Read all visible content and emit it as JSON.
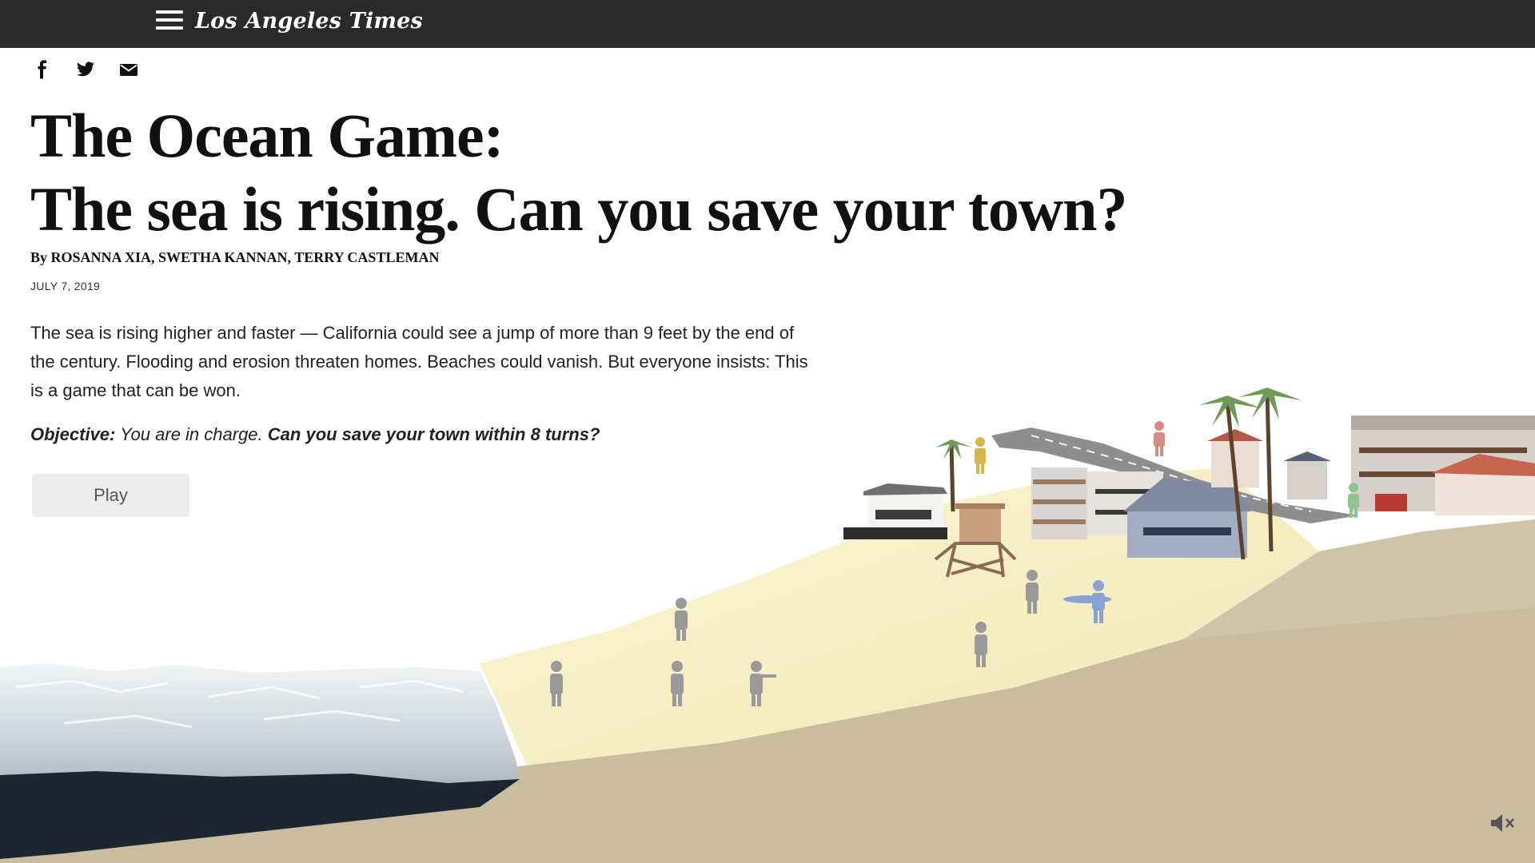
{
  "header": {
    "menu_icon": "hamburger-menu-icon",
    "logo_text": "Los Angeles Times",
    "background": "#2a2a2a"
  },
  "share": {
    "items": [
      {
        "name": "facebook-icon"
      },
      {
        "name": "twitter-icon"
      },
      {
        "name": "email-icon"
      }
    ]
  },
  "article": {
    "headline_line1": "The Ocean Game:",
    "headline_line2": "The sea is rising. Can you save your town?",
    "byline": "By ROSANNA XIA, SWETHA KANNAN, TERRY CASTLEMAN",
    "date": "JULY 7, 2019",
    "intro": "The sea is rising higher and faster — California could see a jump of more than 9 feet by the end of the century. Flooding and erosion threaten homes. Beaches could vanish. But everyone insists: This is a game that can be won.",
    "objective_label": "Objective:",
    "objective_text": " You are in charge. ",
    "objective_goal": "Can you save your town within 8 turns?"
  },
  "game": {
    "play_label": "Play",
    "mute_icon": "speaker-muted-icon",
    "colors": {
      "ocean": "#dde3e6",
      "deep_ocean": "#1c2630",
      "sand": "#f7f0c4",
      "bluff": "#cfc4aa"
    }
  }
}
